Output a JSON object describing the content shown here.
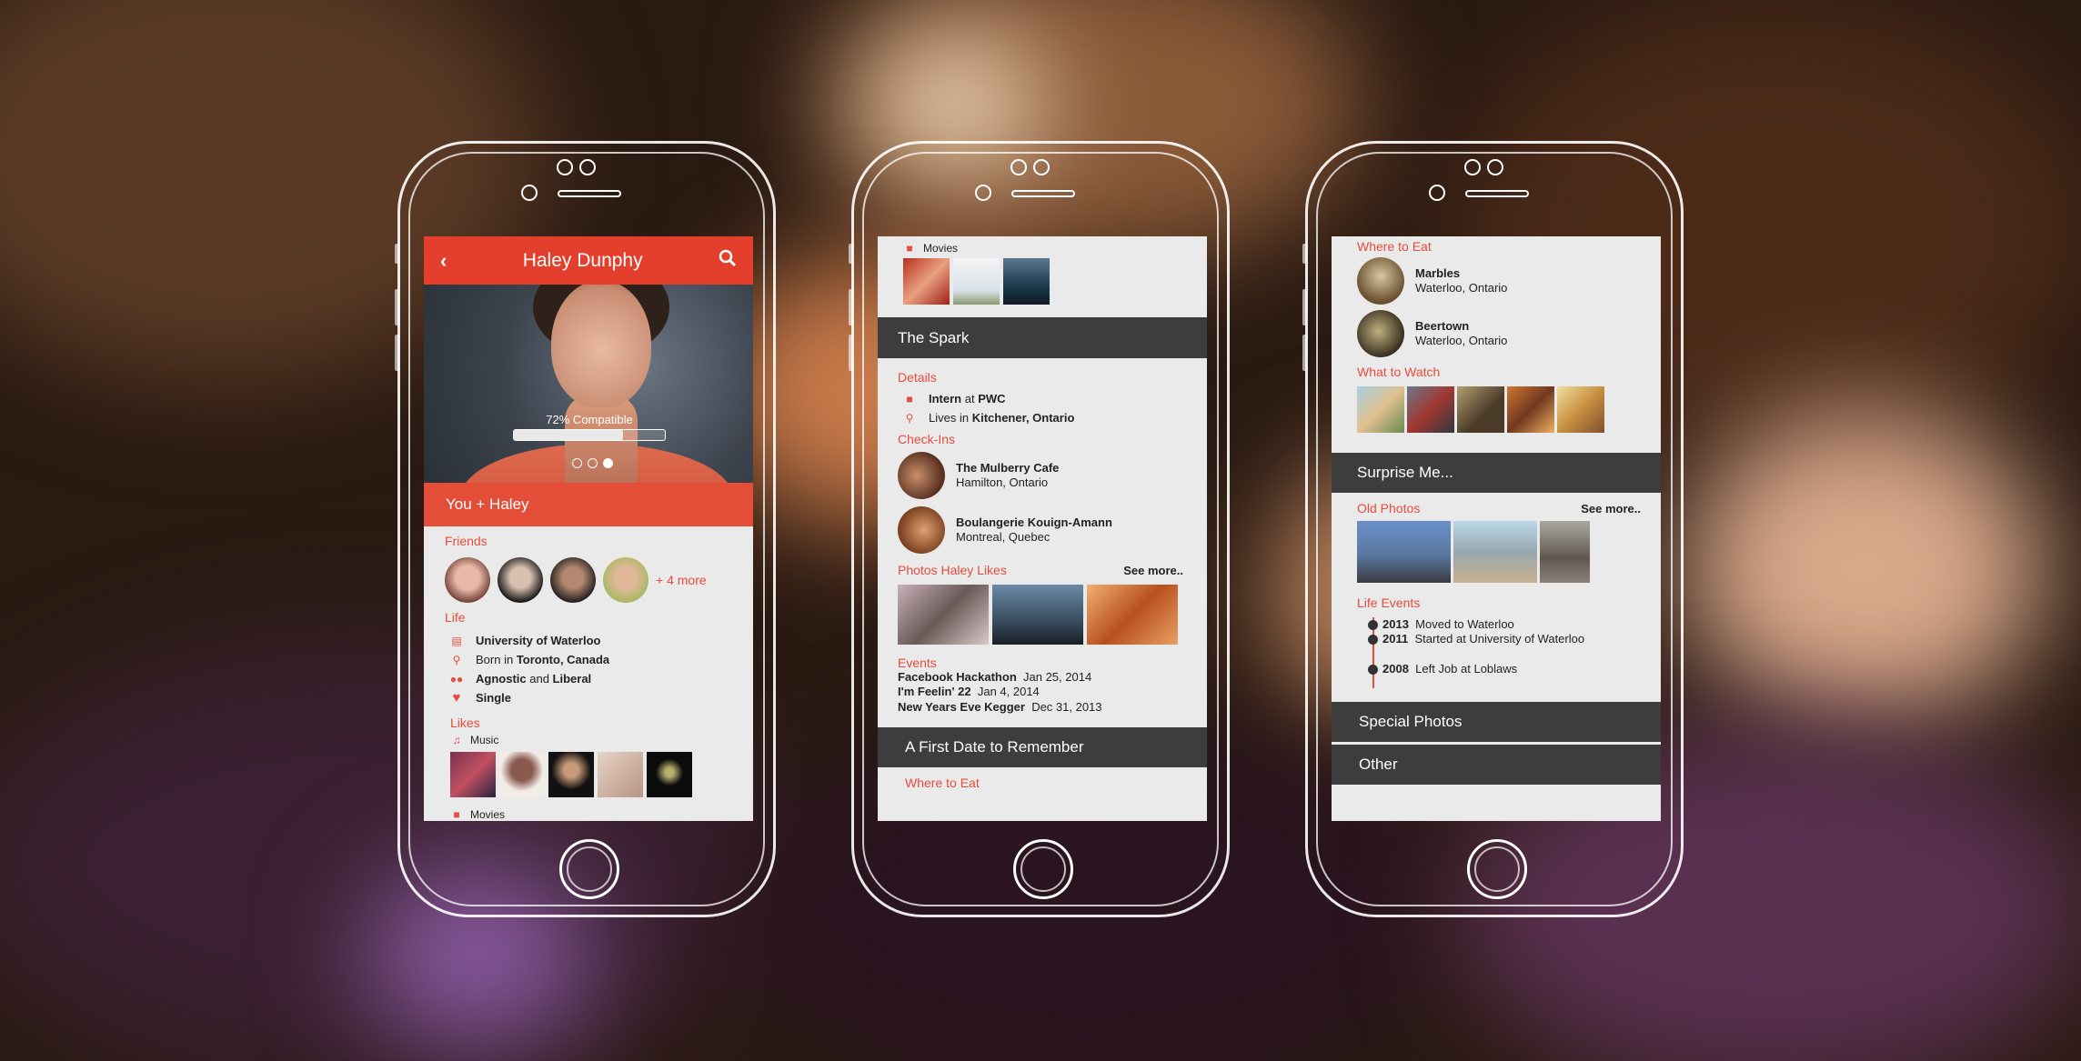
{
  "phone1": {
    "header_title": "Haley Dunphy",
    "compatibility_label": "72% Compatible",
    "compatibility_fraction": 0.72,
    "carousel_active_index": 2,
    "carousel_count": 3,
    "band_label": "You + Haley",
    "friends_title": "Friends",
    "friends_more": "+ 4 more",
    "life_title": "Life",
    "life_items": [
      {
        "icon": "book-icon",
        "bold": "University of Waterloo",
        "rest": ""
      },
      {
        "icon": "location-pin-icon",
        "pre": "Born in ",
        "bold": "Toronto, Canada"
      },
      {
        "icon": "people-icon",
        "bold": "Agnostic",
        "mid": " and ",
        "bold2": "Liberal"
      },
      {
        "icon": "heart-icon",
        "bold": "Single"
      }
    ],
    "likes_title": "Likes",
    "music_label": "Music",
    "movies_cut_label": "Movies"
  },
  "phone2": {
    "movies_label": "Movies",
    "spark_band": "The Spark",
    "details_title": "Details",
    "details": [
      {
        "icon": "briefcase-icon",
        "bold": "Intern",
        "mid": " at ",
        "bold2": "PWC"
      },
      {
        "icon": "location-pin-icon",
        "pre": "Lives in ",
        "bold": "Kitchener, Ontario"
      }
    ],
    "checkins_title": "Check-Ins",
    "checkins": [
      {
        "name": "The Mulberry Cafe",
        "place": "Hamilton, Ontario"
      },
      {
        "name": "Boulangerie Kouign-Amann",
        "place": "Montreal, Quebec"
      }
    ],
    "photos_title": "Photos Haley Likes",
    "see_more": "See more..",
    "events_title": "Events",
    "events": [
      {
        "name": "Facebook Hackathon",
        "date": "Jan 25, 2014"
      },
      {
        "name": "I'm Feelin' 22",
        "date": "Jan 4, 2014"
      },
      {
        "name": "New Years Eve Kegger",
        "date": "Dec 31, 2013"
      }
    ],
    "first_date_band": "A First Date to Remember",
    "where_to_eat_cut": "Where to Eat"
  },
  "phone3": {
    "where_title": "Where to Eat",
    "places": [
      {
        "name": "Marbles",
        "place": "Waterloo, Ontario"
      },
      {
        "name": "Beertown",
        "place": "Waterloo, Ontario"
      }
    ],
    "watch_title": "What to Watch",
    "surprise_band": "Surprise Me...",
    "old_photos_title": "Old Photos",
    "see_more": "See more..",
    "life_events_title": "Life Events",
    "life_events": [
      {
        "year": "2013",
        "text": "Moved to Waterloo"
      },
      {
        "year": "2011",
        "text": "Started at University of Waterloo"
      },
      {
        "year": "2008",
        "text": "Left Job at Loblaws"
      }
    ],
    "special_band": "Special Photos",
    "other_band": "Other"
  },
  "colors": {
    "accent": "#e43f2c",
    "dark_band": "#3d3d3d",
    "screen_bg": "#eaeaea"
  }
}
